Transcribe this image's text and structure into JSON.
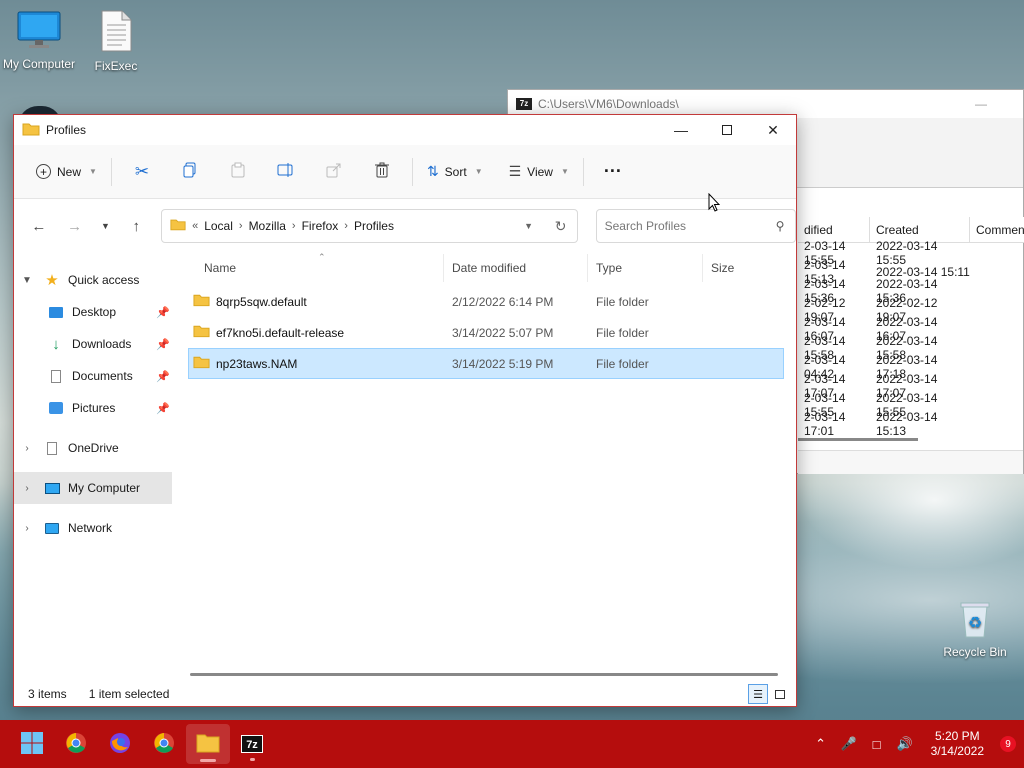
{
  "desktop": {
    "icons": [
      {
        "label": "My Computer"
      },
      {
        "label": "FixExec"
      },
      {
        "label": "Recycle Bin"
      }
    ]
  },
  "bg_window": {
    "title": "C:\\Users\\VM6\\Downloads\\",
    "columns": [
      "dified",
      "Created",
      "Commen"
    ],
    "rows": [
      [
        "2-03-14 15:55",
        "2022-03-14 15:55"
      ],
      [
        "2-03-14 15:13",
        "2022-03-14 15:11"
      ],
      [
        "2-03-14 15:36",
        "2022-03-14 15:36"
      ],
      [
        "2-02-12 19:07",
        "2022-02-12 19:07"
      ],
      [
        "2-03-14 16:07",
        "2022-03-14 16:07"
      ],
      [
        "2-03-14 15:58",
        "2022-03-14 15:58"
      ],
      [
        "2-03-14 04:42",
        "2022-03-14 17:18"
      ],
      [
        "2-03-14 17:07",
        "2022-03-14 17:07"
      ],
      [
        "2-03-14 15:55",
        "2022-03-14 15:55"
      ],
      [
        "2-03-14 17:01",
        "2022-03-14 15:13"
      ]
    ]
  },
  "explorer": {
    "title": "Profiles",
    "toolbar": {
      "new_label": "New",
      "sort_label": "Sort",
      "view_label": "View",
      "more_label": "···"
    },
    "breadcrumb": {
      "overflow": "«",
      "parts": [
        "Local",
        "Mozilla",
        "Firefox",
        "Profiles"
      ]
    },
    "search": {
      "placeholder": "Search Profiles"
    },
    "sidebar": {
      "quick_access": "Quick access",
      "pinned": [
        "Desktop",
        "Downloads",
        "Documents",
        "Pictures"
      ],
      "onedrive": "OneDrive",
      "my_computer": "My Computer",
      "network": "Network"
    },
    "columns": {
      "name": "Name",
      "date": "Date modified",
      "type": "Type",
      "size": "Size"
    },
    "files": [
      {
        "name": "8qrp5sqw.default",
        "date": "2/12/2022 6:14 PM",
        "type": "File folder",
        "size": ""
      },
      {
        "name": "ef7kno5i.default-release",
        "date": "3/14/2022 5:07 PM",
        "type": "File folder",
        "size": ""
      },
      {
        "name": "np23taws.NAM",
        "date": "3/14/2022 5:19 PM",
        "type": "File folder",
        "size": "",
        "selected": true
      }
    ],
    "status": {
      "count": "3 items",
      "selection": "1 item selected"
    }
  },
  "taskbar": {
    "apps": [
      "start",
      "chrome",
      "firefox",
      "chrome",
      "file-explorer",
      "7zip"
    ],
    "time": "5:20 PM",
    "date": "3/14/2022",
    "notifications": "9"
  },
  "colors": {
    "taskbar": "#b50d0d",
    "selection": "#cce8ff",
    "window_border": "#c23a3a"
  }
}
